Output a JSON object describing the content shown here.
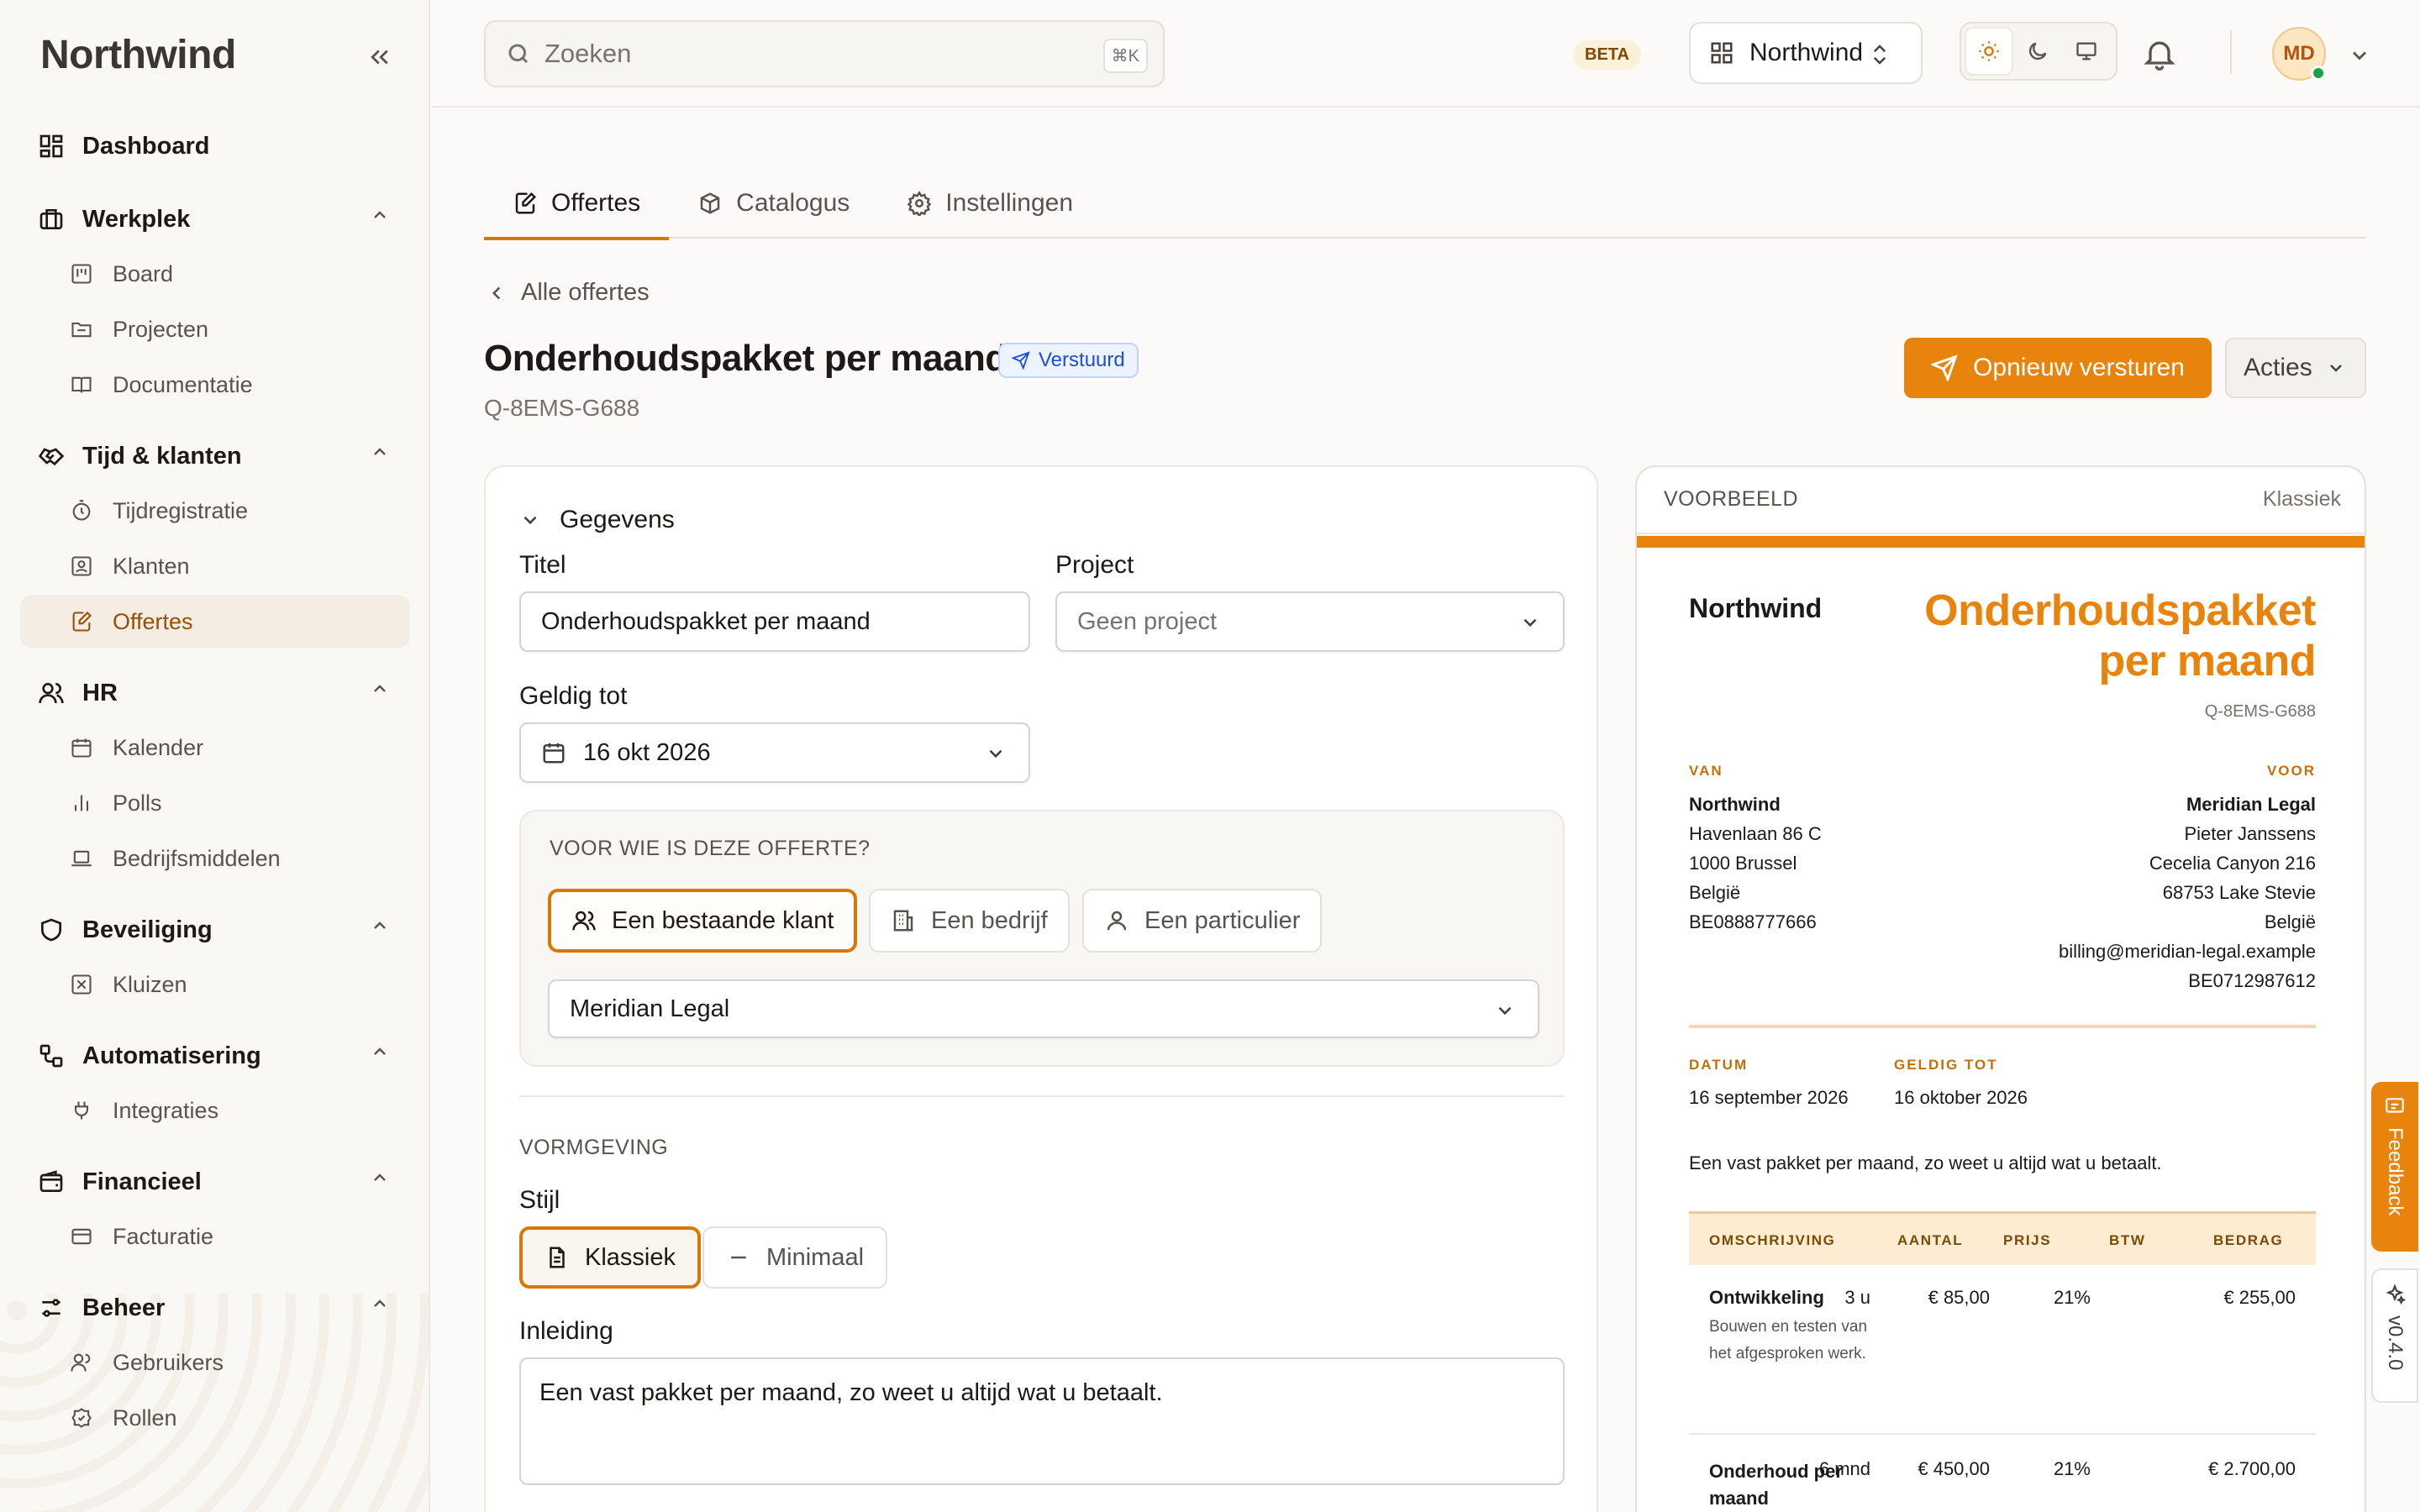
{
  "app": {
    "logo": "Northwind"
  },
  "sidebar": {
    "dashboard": "Dashboard",
    "groups": [
      {
        "label": "Werkplek",
        "items": [
          "Board",
          "Projecten",
          "Documentatie"
        ]
      },
      {
        "label": "Tijd & klanten",
        "items": [
          "Tijdregistratie",
          "Klanten",
          "Offertes"
        ]
      },
      {
        "label": "HR",
        "items": [
          "Kalender",
          "Polls",
          "Bedrijfsmiddelen"
        ]
      },
      {
        "label": "Beveiliging",
        "items": [
          "Kluizen"
        ]
      },
      {
        "label": "Automatisering",
        "items": [
          "Integraties"
        ]
      },
      {
        "label": "Financieel",
        "items": [
          "Facturatie"
        ]
      },
      {
        "label": "Beheer",
        "items": [
          "Gebruikers",
          "Rollen"
        ]
      }
    ],
    "active_item": "Offertes"
  },
  "topbar": {
    "search_placeholder": "Zoeken",
    "search_shortcut": "⌘K",
    "beta": "BETA",
    "workspace": "Northwind",
    "avatar": "MD"
  },
  "tabs": [
    "Offertes",
    "Catalogus",
    "Instellingen"
  ],
  "page": {
    "back": "Alle offertes",
    "title": "Onderhoudspakket per maand",
    "status": "Verstuurd",
    "quote_id": "Q-8EMS-G688",
    "resend_label": "Opnieuw versturen",
    "actions_label": "Acties"
  },
  "form": {
    "section": "Gegevens",
    "title_label": "Titel",
    "title_value": "Onderhoudspakket per maand",
    "project_label": "Project",
    "project_placeholder": "Geen project",
    "valid_label": "Geldig tot",
    "valid_value": "16 okt 2026",
    "who_title": "VOOR WIE IS DEZE OFFERTE?",
    "who_options": [
      "Een bestaande klant",
      "Een bedrijf",
      "Een particulier"
    ],
    "client_value": "Meridian Legal",
    "design_section": "VORMGEVING",
    "style_label": "Stijl",
    "style_options": [
      "Klassiek",
      "Minimaal"
    ],
    "intro_label": "Inleiding",
    "intro_value": "Een vast pakket per maand, zo weet u altijd wat u betaalt."
  },
  "preview": {
    "header": "VOORBEELD",
    "style": "Klassiek",
    "brand": "Northwind",
    "title": "Onderhoudspakket per maand",
    "quote_id": "Q-8EMS-G688",
    "from_cap": "VAN",
    "to_cap": "VOOR",
    "from": [
      "Northwind",
      "Havenlaan 86 C",
      "1000 Brussel",
      "België",
      "BE0888777666"
    ],
    "to": [
      "Meridian Legal",
      "Pieter Janssens",
      "Cecelia Canyon 216",
      "68753 Lake Stevie",
      "België",
      "billing@meridian-legal.example",
      "BE0712987612"
    ],
    "date_cap": "DATUM",
    "date": "16 september 2026",
    "valid_cap": "GELDIG TOT",
    "valid": "16 oktober 2026",
    "intro": "Een vast pakket per maand, zo weet u altijd wat u betaalt.",
    "columns": [
      "OMSCHRIJVING",
      "AANTAL",
      "PRIJS",
      "BTW",
      "BEDRAG"
    ],
    "rows": [
      {
        "name": "Ontwikkeling",
        "desc": "Bouwen en testen van het afgesproken werk.",
        "qty": "3 u",
        "price": "€ 85,00",
        "vat": "21%",
        "amount": "€ 255,00"
      },
      {
        "name": "Onderhoud per maand",
        "desc": "",
        "qty": "6 mnd",
        "price": "€ 450,00",
        "vat": "21%",
        "amount": "€ 2.700,00"
      }
    ]
  },
  "side_tabs": {
    "feedback": "Feedback",
    "version": "v0.4.0"
  },
  "colors": {
    "accent": "#e8830c",
    "status_blue": "#1d4ed8",
    "online": "#16a34a"
  }
}
